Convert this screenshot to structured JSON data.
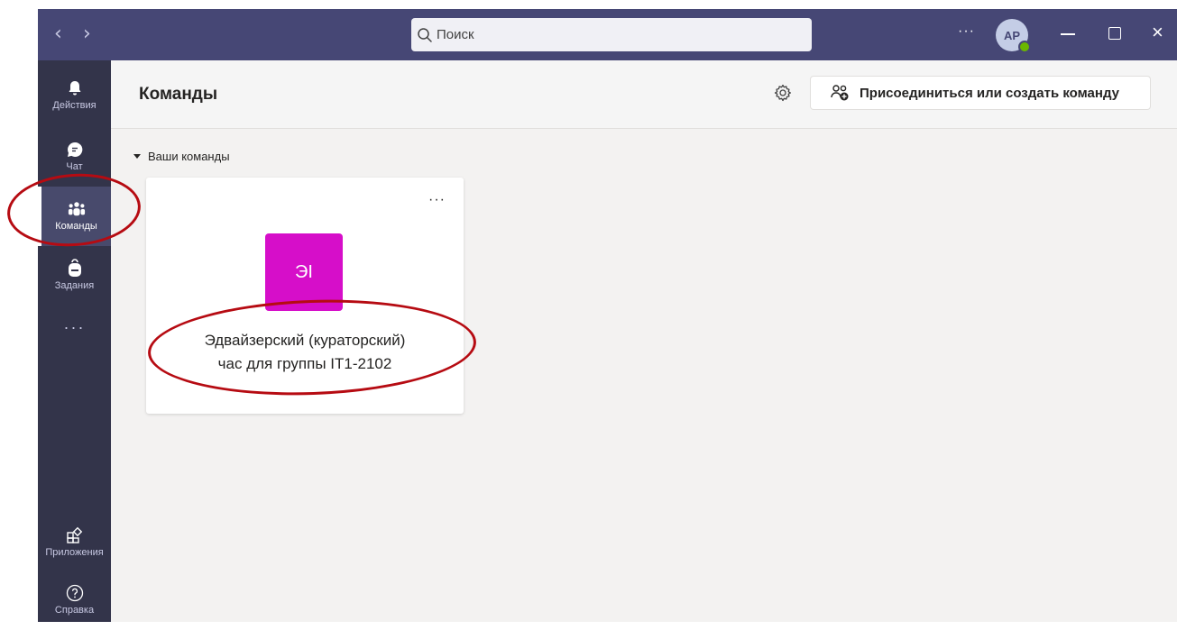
{
  "titlebar": {
    "back_glyph": "‹",
    "forward_glyph": "›",
    "search_placeholder": "Поиск",
    "more_glyph": "···",
    "avatar_initials": "AP",
    "close_glyph": "×"
  },
  "rail": {
    "items": [
      {
        "label": "Действия",
        "icon": "bell-icon"
      },
      {
        "label": "Чат",
        "icon": "chat-icon"
      },
      {
        "label": "Команды",
        "icon": "teams-icon",
        "active": true
      },
      {
        "label": "Задания",
        "icon": "backpack-icon"
      }
    ],
    "more_glyph": "···",
    "bottom_items": [
      {
        "label": "Приложения",
        "icon": "apps-icon"
      },
      {
        "label": "Справка",
        "icon": "help-icon"
      }
    ]
  },
  "header": {
    "title": "Команды",
    "join_button_label": "Присоединиться или создать команду"
  },
  "section": {
    "label": "Ваши команды"
  },
  "team_card": {
    "more_glyph": "···",
    "tile_initials": "ЭI",
    "tile_color": "#d60ec9",
    "name_line_1": "Эдвайзерский (кураторский)",
    "name_line_2": "час для группы IT1-2102"
  },
  "colors": {
    "titlebar": "#464775",
    "rail": "#33344a",
    "annotation": "#b60b12"
  }
}
